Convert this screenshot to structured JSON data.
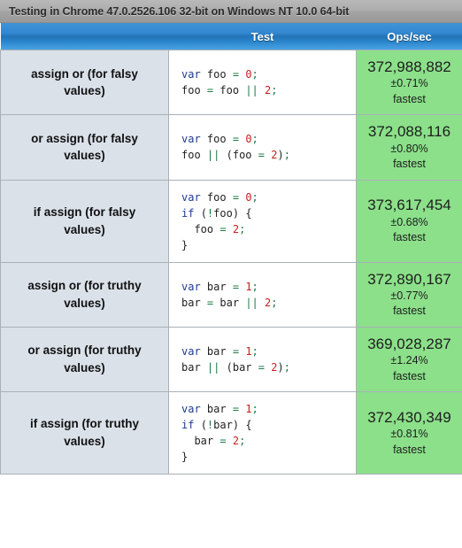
{
  "titlebar": {
    "text": "Testing in Chrome 47.0.2526.106 32-bit on Windows NT 10.0 64-bit"
  },
  "columns": {
    "test": "Test",
    "ops": "Ops/sec"
  },
  "colors": {
    "header_blue": "#2374b9",
    "titlebar_gray": "#a3a3a3",
    "name_cell_bg": "#dae1e9",
    "fastest_green": "#8ce08a",
    "keyword": "#1f3b8f",
    "number": "#c52020",
    "operator": "#1e7a46"
  },
  "rows": [
    {
      "name": "assign or (for falsy values)",
      "code": "var foo = 0;\nfoo = foo || 2;",
      "code_tokens": [
        [
          [
            "var",
            "kw"
          ],
          [
            " ",
            "pun"
          ],
          [
            "foo",
            "id"
          ],
          [
            " ",
            "pun"
          ],
          [
            "=",
            "op"
          ],
          [
            " ",
            "pun"
          ],
          [
            "0",
            "num"
          ],
          [
            ";",
            "semi"
          ]
        ],
        [
          [
            "foo",
            "id"
          ],
          [
            " ",
            "pun"
          ],
          [
            "=",
            "op"
          ],
          [
            " ",
            "pun"
          ],
          [
            "foo",
            "id"
          ],
          [
            " ",
            "pun"
          ],
          [
            "||",
            "op"
          ],
          [
            " ",
            "pun"
          ],
          [
            "2",
            "num"
          ],
          [
            ";",
            "semi"
          ]
        ]
      ],
      "ops": "372,988,882",
      "margin": "±0.71%",
      "rank": "fastest"
    },
    {
      "name": "or assign (for falsy values)",
      "code": "var foo = 0;\nfoo || (foo = 2);",
      "code_tokens": [
        [
          [
            "var",
            "kw"
          ],
          [
            " ",
            "pun"
          ],
          [
            "foo",
            "id"
          ],
          [
            " ",
            "pun"
          ],
          [
            "=",
            "op"
          ],
          [
            " ",
            "pun"
          ],
          [
            "0",
            "num"
          ],
          [
            ";",
            "semi"
          ]
        ],
        [
          [
            "foo",
            "id"
          ],
          [
            " ",
            "pun"
          ],
          [
            "||",
            "op"
          ],
          [
            " ",
            "pun"
          ],
          [
            "(",
            "pun"
          ],
          [
            "foo",
            "id"
          ],
          [
            " ",
            "pun"
          ],
          [
            "=",
            "op"
          ],
          [
            " ",
            "pun"
          ],
          [
            "2",
            "num"
          ],
          [
            ")",
            "pun"
          ],
          [
            ";",
            "semi"
          ]
        ]
      ],
      "ops": "372,088,116",
      "margin": "±0.80%",
      "rank": "fastest"
    },
    {
      "name": "if assign (for falsy values)",
      "code": "var foo = 0;\nif (!foo) {\n  foo = 2;\n}",
      "code_tokens": [
        [
          [
            "var",
            "kw"
          ],
          [
            " ",
            "pun"
          ],
          [
            "foo",
            "id"
          ],
          [
            " ",
            "pun"
          ],
          [
            "=",
            "op"
          ],
          [
            " ",
            "pun"
          ],
          [
            "0",
            "num"
          ],
          [
            ";",
            "semi"
          ]
        ],
        [
          [
            "if",
            "kw"
          ],
          [
            " ",
            "pun"
          ],
          [
            "(",
            "pun"
          ],
          [
            "!",
            "op"
          ],
          [
            "foo",
            "id"
          ],
          [
            ")",
            "pun"
          ],
          [
            " ",
            "pun"
          ],
          [
            "{",
            "pun"
          ]
        ],
        [
          [
            "  ",
            "pun"
          ],
          [
            "foo",
            "id"
          ],
          [
            " ",
            "pun"
          ],
          [
            "=",
            "op"
          ],
          [
            " ",
            "pun"
          ],
          [
            "2",
            "num"
          ],
          [
            ";",
            "semi"
          ]
        ],
        [
          [
            "}",
            "pun"
          ]
        ]
      ],
      "ops": "373,617,454",
      "margin": "±0.68%",
      "rank": "fastest"
    },
    {
      "name": "assign or (for truthy values)",
      "code": "var bar = 1;\nbar = bar || 2;",
      "code_tokens": [
        [
          [
            "var",
            "kw"
          ],
          [
            " ",
            "pun"
          ],
          [
            "bar",
            "id"
          ],
          [
            " ",
            "pun"
          ],
          [
            "=",
            "op"
          ],
          [
            " ",
            "pun"
          ],
          [
            "1",
            "num"
          ],
          [
            ";",
            "semi"
          ]
        ],
        [
          [
            "bar",
            "id"
          ],
          [
            " ",
            "pun"
          ],
          [
            "=",
            "op"
          ],
          [
            " ",
            "pun"
          ],
          [
            "bar",
            "id"
          ],
          [
            " ",
            "pun"
          ],
          [
            "||",
            "op"
          ],
          [
            " ",
            "pun"
          ],
          [
            "2",
            "num"
          ],
          [
            ";",
            "semi"
          ]
        ]
      ],
      "ops": "372,890,167",
      "margin": "±0.77%",
      "rank": "fastest"
    },
    {
      "name": "or assign (for truthy values)",
      "code": "var bar = 1;\nbar || (bar = 2);",
      "code_tokens": [
        [
          [
            "var",
            "kw"
          ],
          [
            " ",
            "pun"
          ],
          [
            "bar",
            "id"
          ],
          [
            " ",
            "pun"
          ],
          [
            "=",
            "op"
          ],
          [
            " ",
            "pun"
          ],
          [
            "1",
            "num"
          ],
          [
            ";",
            "semi"
          ]
        ],
        [
          [
            "bar",
            "id"
          ],
          [
            " ",
            "pun"
          ],
          [
            "||",
            "op"
          ],
          [
            " ",
            "pun"
          ],
          [
            "(",
            "pun"
          ],
          [
            "bar",
            "id"
          ],
          [
            " ",
            "pun"
          ],
          [
            "=",
            "op"
          ],
          [
            " ",
            "pun"
          ],
          [
            "2",
            "num"
          ],
          [
            ")",
            "pun"
          ],
          [
            ";",
            "semi"
          ]
        ]
      ],
      "ops": "369,028,287",
      "margin": "±1.24%",
      "rank": "fastest"
    },
    {
      "name": "if assign (for truthy values)",
      "code": "var bar = 1;\nif (!bar) {\n  bar = 2;\n}",
      "code_tokens": [
        [
          [
            "var",
            "kw"
          ],
          [
            " ",
            "pun"
          ],
          [
            "bar",
            "id"
          ],
          [
            " ",
            "pun"
          ],
          [
            "=",
            "op"
          ],
          [
            " ",
            "pun"
          ],
          [
            "1",
            "num"
          ],
          [
            ";",
            "semi"
          ]
        ],
        [
          [
            "if",
            "kw"
          ],
          [
            " ",
            "pun"
          ],
          [
            "(",
            "pun"
          ],
          [
            "!",
            "op"
          ],
          [
            "bar",
            "id"
          ],
          [
            ")",
            "pun"
          ],
          [
            " ",
            "pun"
          ],
          [
            "{",
            "pun"
          ]
        ],
        [
          [
            "  ",
            "pun"
          ],
          [
            "bar",
            "id"
          ],
          [
            " ",
            "pun"
          ],
          [
            "=",
            "op"
          ],
          [
            " ",
            "pun"
          ],
          [
            "2",
            "num"
          ],
          [
            ";",
            "semi"
          ]
        ],
        [
          [
            "}",
            "pun"
          ]
        ]
      ],
      "ops": "372,430,349",
      "margin": "±0.81%",
      "rank": "fastest"
    }
  ]
}
